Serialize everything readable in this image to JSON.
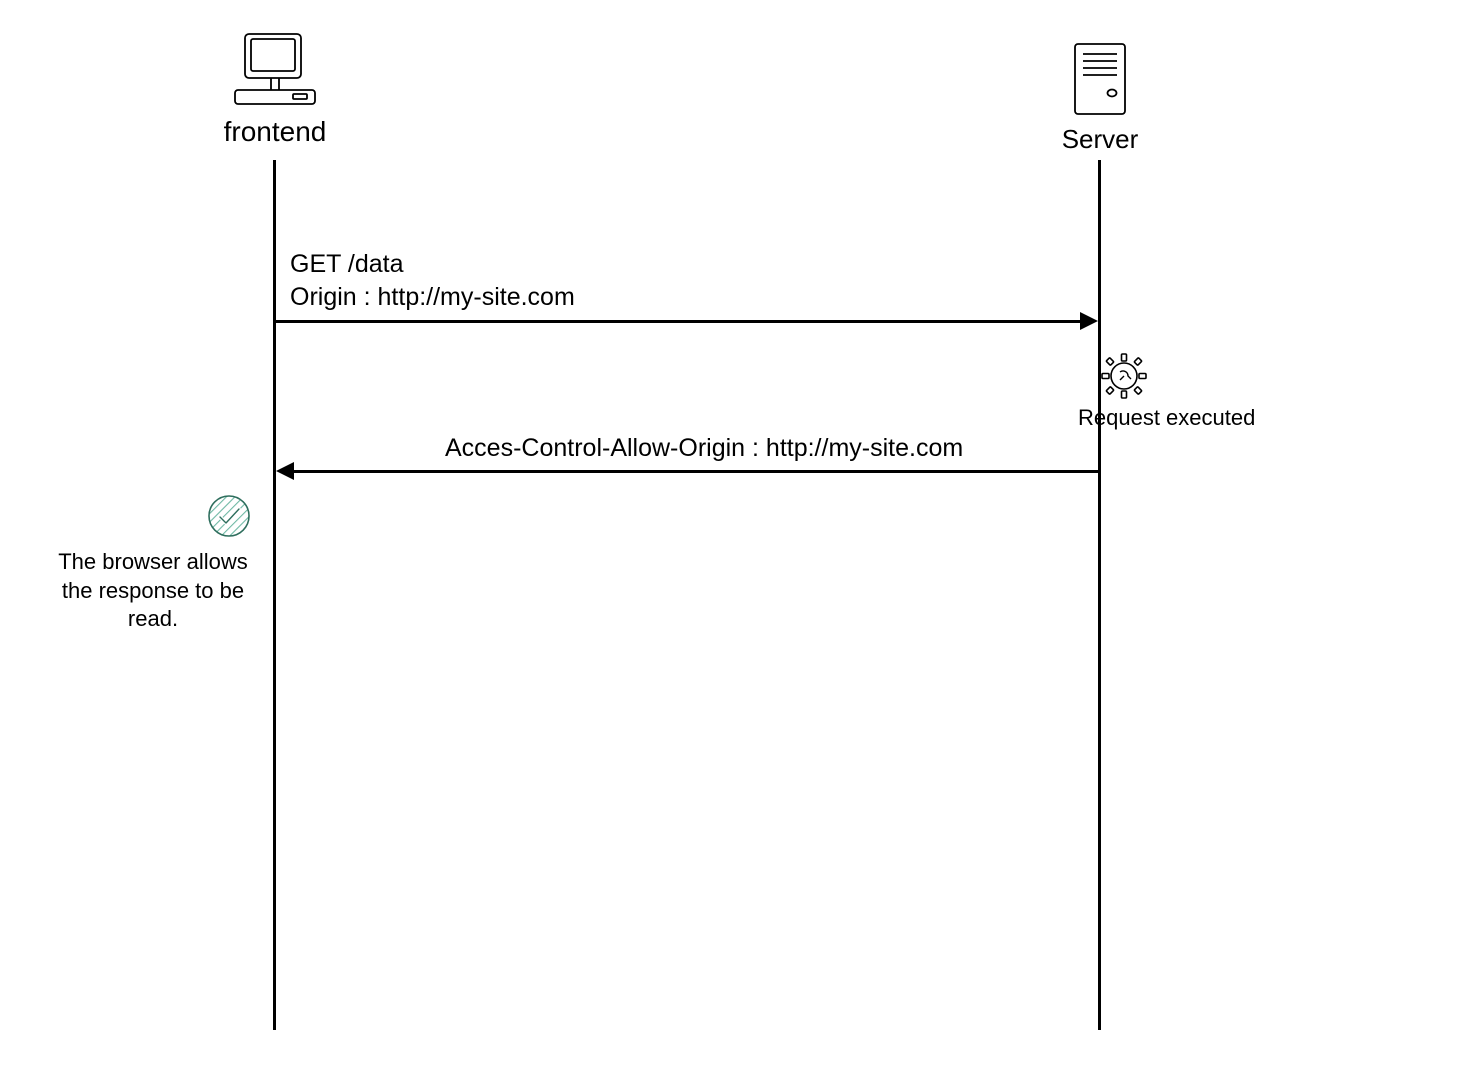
{
  "actors": {
    "frontend": {
      "label": "frontend"
    },
    "server": {
      "label": "Server"
    }
  },
  "messages": {
    "request": {
      "line1": "GET /data",
      "line2": "Origin : http://my-site.com"
    },
    "response": {
      "line1": "Acces-Control-Allow-Origin : http://my-site.com"
    }
  },
  "annotations": {
    "server_side": "Request executed",
    "client_side": "The browser allows\nthe response to be read."
  },
  "icons": {
    "frontend": "computer-icon",
    "server": "server-icon",
    "processing": "gear-icon",
    "success": "check-icon"
  }
}
